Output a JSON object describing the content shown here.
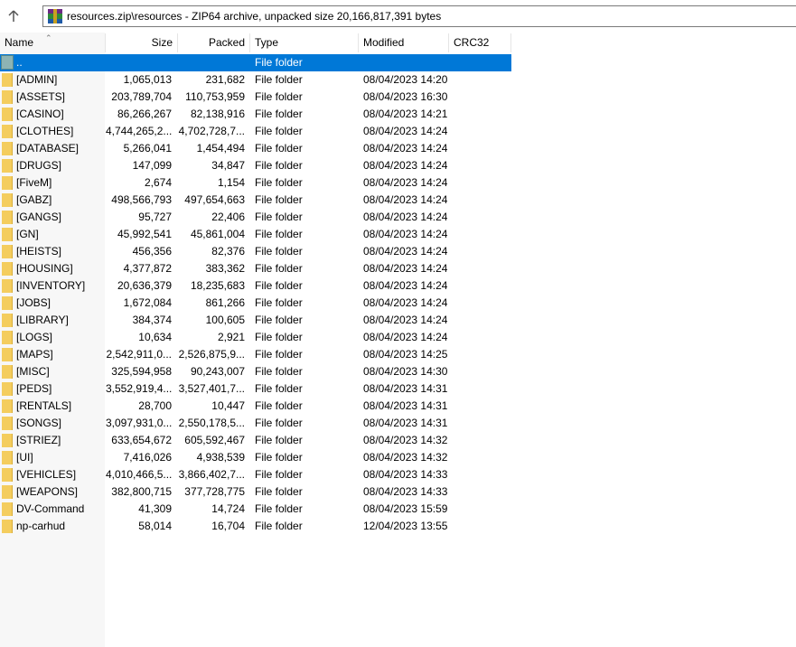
{
  "window": {
    "address": "resources.zip\\resources - ZIP64 archive, unpacked size 20,166,817,391 bytes"
  },
  "columns": {
    "name": "Name",
    "size": "Size",
    "packed": "Packed",
    "type": "Type",
    "modified": "Modified",
    "crc": "CRC32"
  },
  "parent_row": {
    "name": "..",
    "type": "File folder"
  },
  "rows": [
    {
      "name": "[ADMIN]",
      "size": "1,065,013",
      "packed": "231,682",
      "type": "File folder",
      "modified": "08/04/2023 14:20"
    },
    {
      "name": "[ASSETS]",
      "size": "203,789,704",
      "packed": "110,753,959",
      "type": "File folder",
      "modified": "08/04/2023 16:30"
    },
    {
      "name": "[CASINO]",
      "size": "86,266,267",
      "packed": "82,138,916",
      "type": "File folder",
      "modified": "08/04/2023 14:21"
    },
    {
      "name": "[CLOTHES]",
      "size": "4,744,265,2...",
      "packed": "4,702,728,7...",
      "type": "File folder",
      "modified": "08/04/2023 14:24"
    },
    {
      "name": "[DATABASE]",
      "size": "5,266,041",
      "packed": "1,454,494",
      "type": "File folder",
      "modified": "08/04/2023 14:24"
    },
    {
      "name": "[DRUGS]",
      "size": "147,099",
      "packed": "34,847",
      "type": "File folder",
      "modified": "08/04/2023 14:24"
    },
    {
      "name": "[FiveM]",
      "size": "2,674",
      "packed": "1,154",
      "type": "File folder",
      "modified": "08/04/2023 14:24"
    },
    {
      "name": "[GABZ]",
      "size": "498,566,793",
      "packed": "497,654,663",
      "type": "File folder",
      "modified": "08/04/2023 14:24"
    },
    {
      "name": "[GANGS]",
      "size": "95,727",
      "packed": "22,406",
      "type": "File folder",
      "modified": "08/04/2023 14:24"
    },
    {
      "name": "[GN]",
      "size": "45,992,541",
      "packed": "45,861,004",
      "type": "File folder",
      "modified": "08/04/2023 14:24"
    },
    {
      "name": "[HEISTS]",
      "size": "456,356",
      "packed": "82,376",
      "type": "File folder",
      "modified": "08/04/2023 14:24"
    },
    {
      "name": "[HOUSING]",
      "size": "4,377,872",
      "packed": "383,362",
      "type": "File folder",
      "modified": "08/04/2023 14:24"
    },
    {
      "name": "[INVENTORY]",
      "size": "20,636,379",
      "packed": "18,235,683",
      "type": "File folder",
      "modified": "08/04/2023 14:24"
    },
    {
      "name": "[JOBS]",
      "size": "1,672,084",
      "packed": "861,266",
      "type": "File folder",
      "modified": "08/04/2023 14:24"
    },
    {
      "name": "[LIBRARY]",
      "size": "384,374",
      "packed": "100,605",
      "type": "File folder",
      "modified": "08/04/2023 14:24"
    },
    {
      "name": "[LOGS]",
      "size": "10,634",
      "packed": "2,921",
      "type": "File folder",
      "modified": "08/04/2023 14:24"
    },
    {
      "name": "[MAPS]",
      "size": "2,542,911,0...",
      "packed": "2,526,875,9...",
      "type": "File folder",
      "modified": "08/04/2023 14:25"
    },
    {
      "name": "[MISC]",
      "size": "325,594,958",
      "packed": "90,243,007",
      "type": "File folder",
      "modified": "08/04/2023 14:30"
    },
    {
      "name": "[PEDS]",
      "size": "3,552,919,4...",
      "packed": "3,527,401,7...",
      "type": "File folder",
      "modified": "08/04/2023 14:31"
    },
    {
      "name": "[RENTALS]",
      "size": "28,700",
      "packed": "10,447",
      "type": "File folder",
      "modified": "08/04/2023 14:31"
    },
    {
      "name": "[SONGS]",
      "size": "3,097,931,0...",
      "packed": "2,550,178,5...",
      "type": "File folder",
      "modified": "08/04/2023 14:31"
    },
    {
      "name": "[STRIEZ]",
      "size": "633,654,672",
      "packed": "605,592,467",
      "type": "File folder",
      "modified": "08/04/2023 14:32"
    },
    {
      "name": "[UI]",
      "size": "7,416,026",
      "packed": "4,938,539",
      "type": "File folder",
      "modified": "08/04/2023 14:32"
    },
    {
      "name": "[VEHICLES]",
      "size": "4,010,466,5...",
      "packed": "3,866,402,7...",
      "type": "File folder",
      "modified": "08/04/2023 14:33"
    },
    {
      "name": "[WEAPONS]",
      "size": "382,800,715",
      "packed": "377,728,775",
      "type": "File folder",
      "modified": "08/04/2023 14:33"
    },
    {
      "name": "DV-Command",
      "size": "41,309",
      "packed": "14,724",
      "type": "File folder",
      "modified": "08/04/2023 15:59"
    },
    {
      "name": "np-carhud",
      "size": "58,014",
      "packed": "16,704",
      "type": "File folder",
      "modified": "12/04/2023 13:55"
    }
  ],
  "colors": {
    "selection": "#0078d7",
    "folder": "#f4cd5e",
    "left_strip": "#f7f7f7"
  }
}
